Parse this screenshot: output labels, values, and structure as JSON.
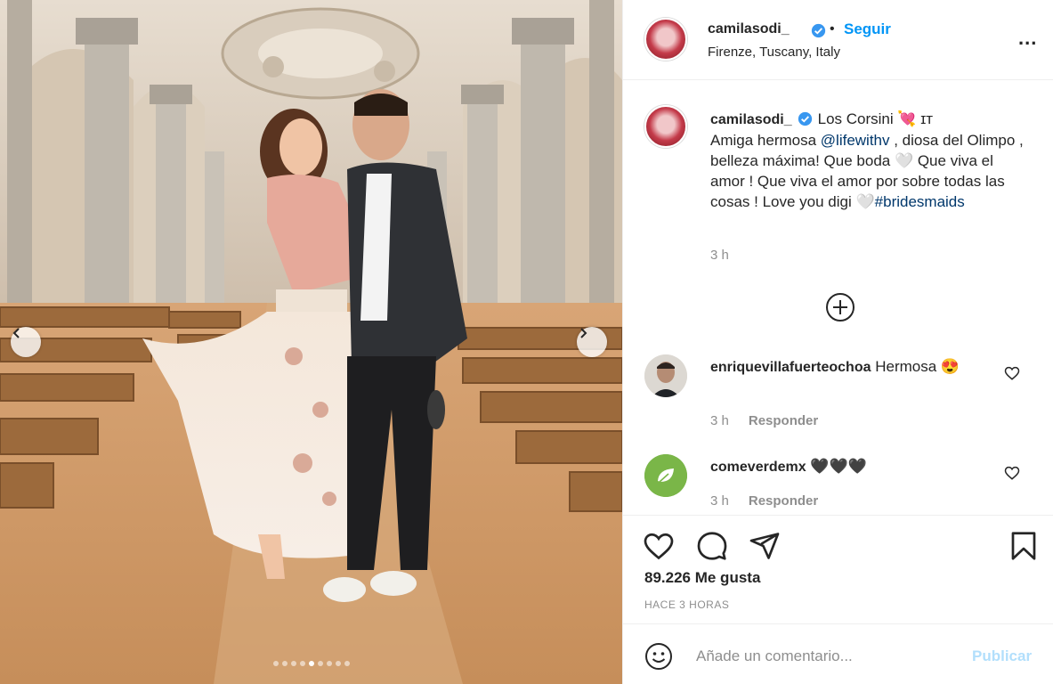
{
  "post": {
    "carousel": {
      "slide_count": 9,
      "active_index": 4
    }
  },
  "header": {
    "username": "camilasodi_",
    "separator": "•",
    "follow_label": "Seguir",
    "location": "Firenze, Tuscany, Italy",
    "more_label": "..."
  },
  "caption": {
    "username": "camilasodi_",
    "title": "Los Corsini 💘 ɪᴛ",
    "line_intro": "Amiga hermosa ",
    "mention": "@lifewithv",
    "line_rest": " , diosa del Olimpo , belleza máxima! Que boda 🤍 Que viva el amor ! Que viva el amor por sobre todas las cosas ! Love you digi 🤍",
    "hashtag": "#bridesmaids",
    "time": "3 h"
  },
  "comments": [
    {
      "username": "enriquevillafuerteochoa",
      "text": "Hermosa 😍",
      "time": "3 h",
      "reply_label": "Responder"
    },
    {
      "username": "comeverdemx",
      "text": "🖤🖤🖤",
      "time": "3 h",
      "reply_label": "Responder"
    }
  ],
  "actions": {
    "likes": "89.226 Me gusta",
    "posted_ago": "HACE 3 HORAS"
  },
  "add_comment": {
    "placeholder": "Añade un comentario...",
    "publish_label": "Publicar"
  },
  "colors": {
    "accent": "#0095f6",
    "publish_disabled": "#b2dffc",
    "verified": "#3897f0",
    "secondary_text": "#8e8e8e",
    "border": "#efefef"
  },
  "icons": [
    "chevron-left-icon",
    "chevron-right-icon",
    "verified-badge-icon",
    "more-options-icon",
    "add-circle-icon",
    "heart-icon",
    "comment-icon",
    "share-icon",
    "bookmark-icon",
    "emoji-icon"
  ]
}
